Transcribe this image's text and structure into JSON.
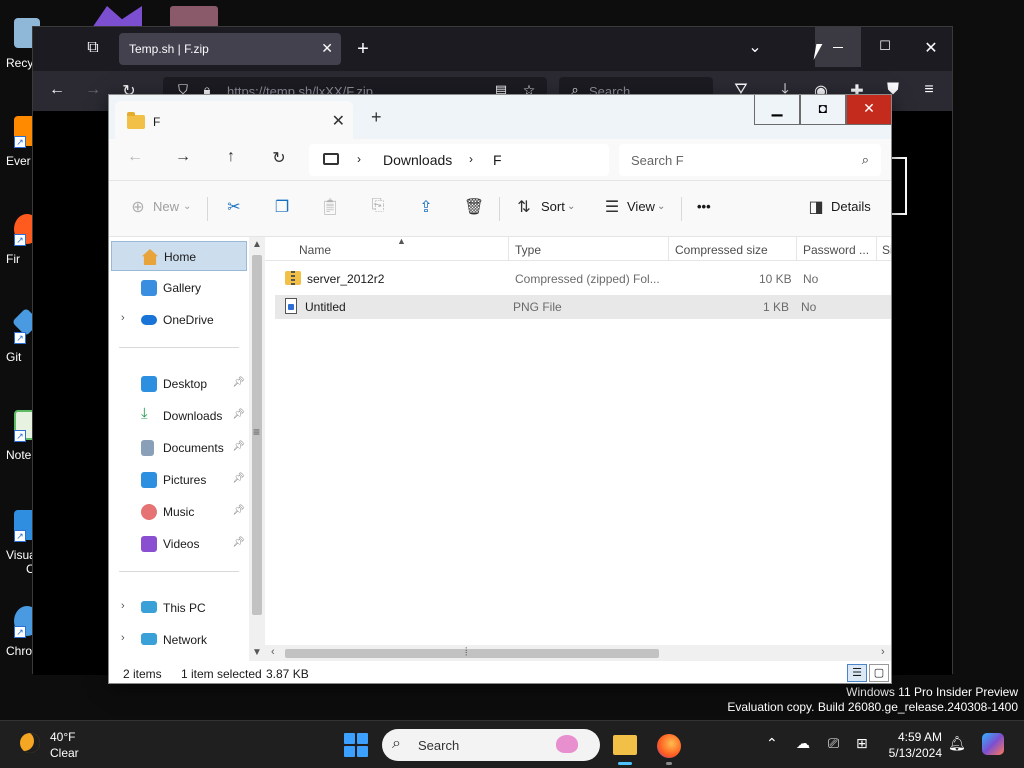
{
  "desktop": {
    "icons": [
      {
        "label": "Recy",
        "color": "#8fb7d8"
      },
      {
        "label": "Ever",
        "color": "#ff8a00"
      },
      {
        "label": "Fir",
        "color": "#ff5b1e"
      },
      {
        "label": "Git",
        "color": "#4a9ae1"
      },
      {
        "label": "Note",
        "color": "#5dbb63"
      },
      {
        "label": "Visua",
        "label2": "C",
        "color": "#2f8ee0"
      },
      {
        "label": "Chro",
        "color": "#4a9ae1"
      }
    ],
    "watermark_line1": "Windows 11 Pro Insider Preview",
    "watermark_line2": "Evaluation copy. Build 26080.ge_release.240308-1400"
  },
  "browser": {
    "tab_title": "Temp.sh | F.zip",
    "url": "https://temp.sh/lxXX/F.zip",
    "search_placeholder": "Search"
  },
  "explorer": {
    "tab_title": "F",
    "breadcrumbs": [
      "Downloads",
      "F"
    ],
    "search_placeholder": "Search F",
    "commands": {
      "new": "New",
      "sort": "Sort",
      "view": "View",
      "more": "•••",
      "details": "Details"
    },
    "nav_pane": {
      "home": "Home",
      "gallery": "Gallery",
      "onedrive": "OneDrive",
      "desktop": "Desktop",
      "downloads": "Downloads",
      "documents": "Documents",
      "pictures": "Pictures",
      "music": "Music",
      "videos": "Videos",
      "thispc": "This PC",
      "network": "Network"
    },
    "columns": [
      "Name",
      "Type",
      "Compressed size",
      "Password ...",
      "Si"
    ],
    "files": [
      {
        "name": "server_2012r2",
        "type": "Compressed (zipped) Fol...",
        "size": "10 KB",
        "password": "No"
      },
      {
        "name": "Untitled",
        "type": "PNG File",
        "size": "1 KB",
        "password": "No"
      }
    ],
    "status": {
      "count": "2 items",
      "selected": "1 item selected",
      "size": "3.87 KB"
    }
  },
  "taskbar": {
    "temp": "40°F",
    "condition": "Clear",
    "search": "Search",
    "time": "4:59 AM",
    "date": "5/13/2024"
  }
}
